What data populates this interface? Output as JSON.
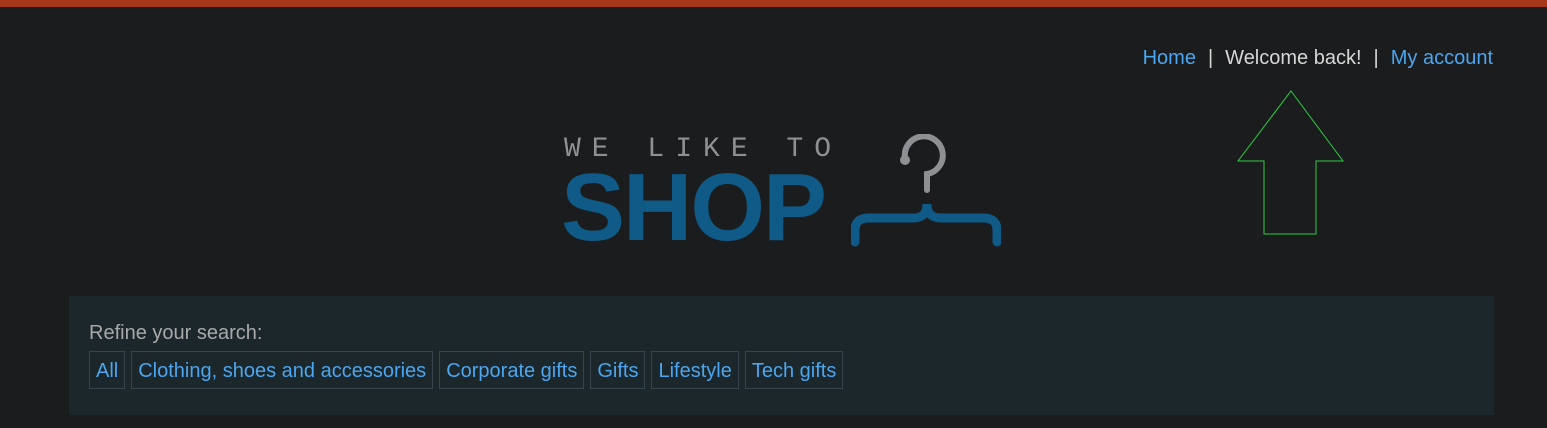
{
  "nav": {
    "home": "Home",
    "separator": "|",
    "welcome": "Welcome back!",
    "my_account": "My account"
  },
  "logo": {
    "tagline": "WE LIKE TO",
    "name": "SHOP"
  },
  "filters": {
    "label": "Refine your search:",
    "categories": [
      "All",
      "Clothing, shoes and accessories",
      "Corporate gifts",
      "Gifts",
      "Lifestyle",
      "Tech gifts"
    ]
  },
  "colors": {
    "background": "#1b1c1e",
    "accent_bar": "#a63718",
    "link": "#4ba6ef",
    "logo_blue": "#0f5a86",
    "panel": "#1c272c",
    "arrow_outline": "#2ecc40"
  },
  "icons": {
    "logo_icon": "hanger-icon",
    "pointer": "up-arrow-icon"
  }
}
